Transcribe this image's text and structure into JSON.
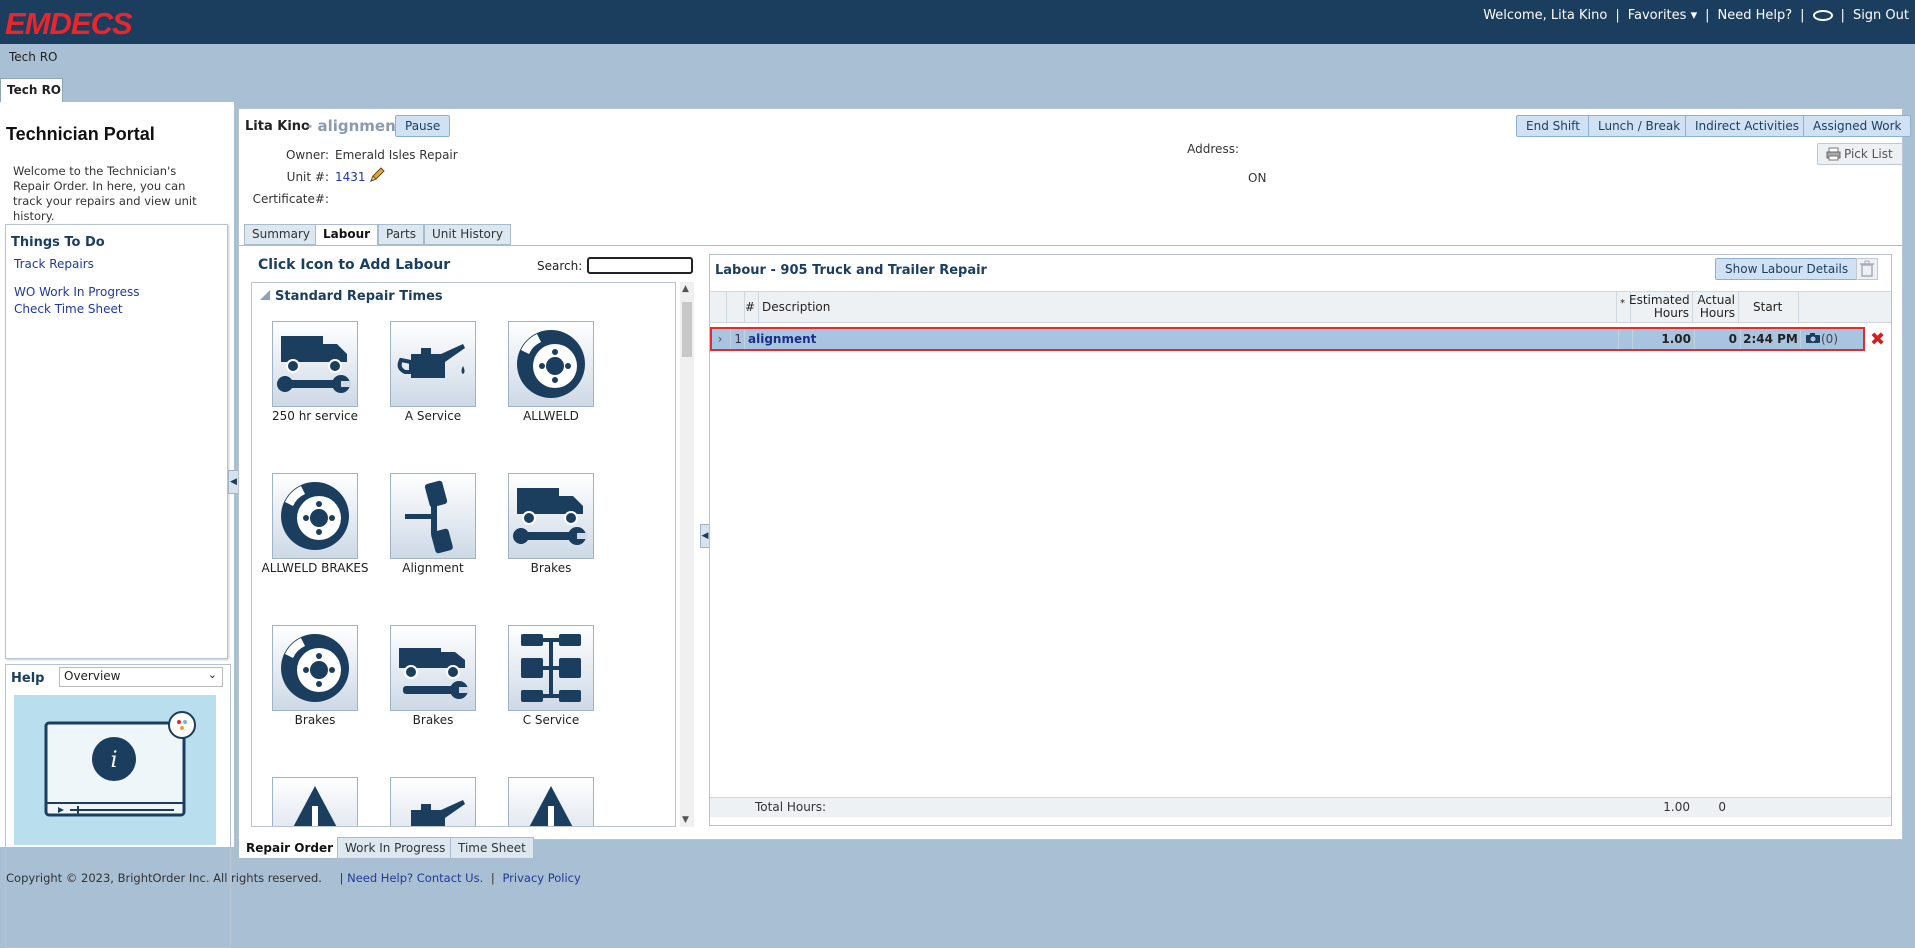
{
  "header": {
    "logo": "EMDECS",
    "welcome": "Welcome, Lita Kino",
    "favorites": "Favorites",
    "need_help": "Need Help?",
    "sign_out": "Sign Out"
  },
  "breadcrumb": "Tech RO",
  "app_tab": "Tech RO",
  "sidebar": {
    "title": "Technician Portal",
    "description": "Welcome to the Technician's Repair Order. In here, you can track your repairs and view unit history.",
    "todo_title": "Things To Do",
    "links": [
      "Track Repairs",
      "WO Work In Progress",
      "Check Time Sheet"
    ],
    "help_label": "Help",
    "help_selected": "Overview"
  },
  "ro": {
    "tech_name": "Lita Kino",
    "work_order": "- alignment",
    "pause_label": "Pause",
    "owner_label": "Owner:",
    "owner_value": "Emerald Isles Repair",
    "unit_label": "Unit #:",
    "unit_value": "1431",
    "cert_label": "Certificate#:",
    "address_label": "Address:",
    "address_value": "ON",
    "actions": [
      "End Shift",
      "Lunch / Break",
      "Indirect Activities",
      "Assigned Work"
    ],
    "pick_list": "Pick List"
  },
  "tabs": [
    "Summary",
    "Labour",
    "Parts",
    "Unit History"
  ],
  "picker": {
    "title": "Click Icon to Add Labour",
    "search_label": "Search:",
    "section": "Standard Repair Times",
    "tiles": [
      "250 hr service",
      "A Service",
      "ALLWELD",
      "ALLWELD BRAKES",
      "Alignment",
      "Brakes",
      "Brakes",
      "Brakes",
      "C Service"
    ]
  },
  "labour": {
    "title": "Labour - 905 Truck and Trailer Repair",
    "show_details": "Show Labour Details",
    "columns": {
      "num": "#",
      "desc": "Description",
      "star": "*",
      "est": "Estimated Hours",
      "act": "Actual Hours",
      "start": "Start"
    },
    "rows": [
      {
        "num": "1",
        "desc": "alignment",
        "est": "1.00",
        "act": "0",
        "start": "2:44 PM",
        "notes": "(0)"
      }
    ],
    "total_label": "Total Hours:",
    "total_est": "1.00",
    "total_act": "0"
  },
  "bottom_tabs": [
    "Repair Order",
    "Work In Progress",
    "Time Sheet"
  ],
  "footer": {
    "copyright": "Copyright © 2023, BrightOrder Inc. All rights reserved.",
    "contact": "Need Help? Contact Us.",
    "privacy": "Privacy Policy"
  },
  "colors": {
    "brand_red": "#e8262b",
    "header_bg": "#1b3d5e",
    "accent": "#1b3d5e",
    "row_highlight": "#a9c4e0"
  }
}
